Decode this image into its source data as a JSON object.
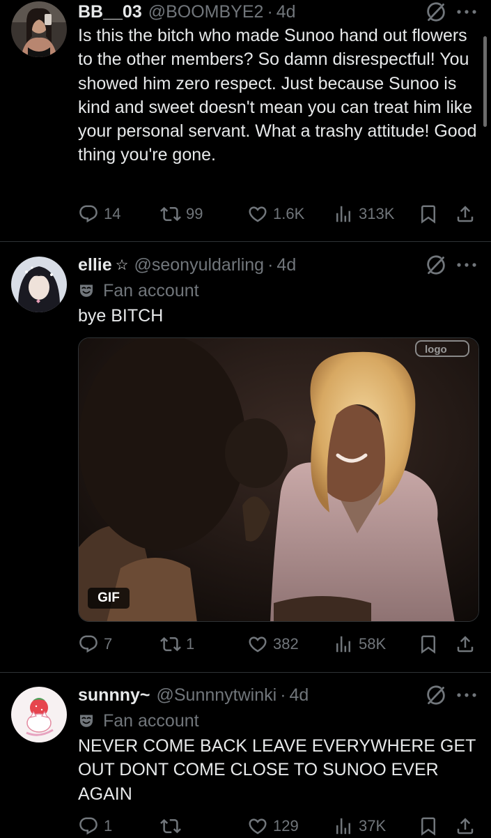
{
  "posts": [
    {
      "display_name": "BB__03",
      "handle": "@BOOMBYE2",
      "separator": "·",
      "time": "4d",
      "text": "Is this the bitch who made Sunoo hand out flowers to the other members? So damn disrespectful! You showed him zero respect. Just because Sunoo is kind and sweet doesn't mean you can treat him like your personal servant. What a trashy attitude! Good thing you're gone.",
      "replies": "14",
      "reposts": "99",
      "likes": "1.6K",
      "views": "313K"
    },
    {
      "display_name": "ellie",
      "name_emoji": "☆",
      "handle": "@seonyuldarling",
      "separator": "·",
      "time": "4d",
      "label": "Fan account",
      "text": "bye BITCH",
      "media_badge": "GIF",
      "media_watermark": "logo",
      "replies": "7",
      "reposts": "1",
      "likes": "382",
      "views": "58K"
    },
    {
      "display_name": "sunnny~",
      "handle": "@Sunnnytwinki",
      "separator": "·",
      "time": "4d",
      "label": "Fan account",
      "text": "NEVER COME BACK LEAVE EVERYWHERE GET OUT DONT COME CLOSE TO SUNOO EVER AGAIN",
      "replies": "1",
      "reposts": "",
      "likes": "129",
      "views": "37K"
    }
  ],
  "icons": {
    "reply": "reply-icon",
    "repost": "repost-icon",
    "like": "heart-icon",
    "views": "views-icon",
    "bookmark": "bookmark-icon",
    "share": "share-icon",
    "grok": "grok-icon",
    "more": "more-icon",
    "fan_label": "theater-mask-icon"
  },
  "colors": {
    "background": "#000000",
    "primary_text": "#e7e9ea",
    "secondary_text": "#71767b",
    "divider": "#2f3336"
  }
}
